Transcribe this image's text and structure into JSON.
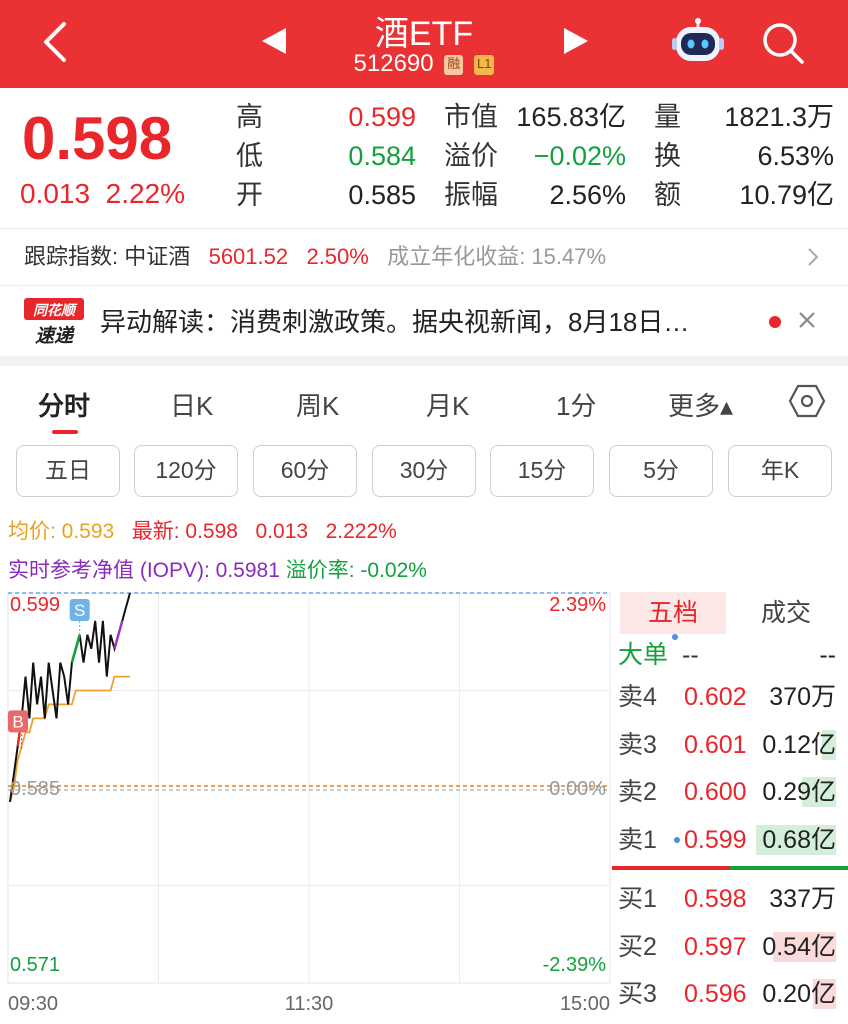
{
  "header": {
    "title": "酒ETF",
    "code": "512690",
    "tag_margin": "融",
    "tag_level": "L1",
    "bg_color": "#ea3133"
  },
  "quote": {
    "price": "0.598",
    "change": "0.013",
    "change_pct": "2.22%",
    "col1": [
      {
        "label": "高",
        "value": "0.599",
        "color": "red"
      },
      {
        "label": "低",
        "value": "0.584",
        "color": "green"
      },
      {
        "label": "开",
        "value": "0.585",
        "color": "black"
      }
    ],
    "col2": [
      {
        "label": "市值",
        "value": "165.83亿"
      },
      {
        "label": "溢价",
        "value": "−0.02%"
      },
      {
        "label": "振幅",
        "value": "2.56%"
      }
    ],
    "col3": [
      {
        "label": "量",
        "value": "1821.3万"
      },
      {
        "label": "换",
        "value": "6.53%"
      },
      {
        "label": "额",
        "value": "10.79亿"
      }
    ]
  },
  "tracking": {
    "label": "跟踪指数: 中证酒",
    "index_value": "5601.52",
    "index_pct": "2.50%",
    "annual_label": "成立年化收益: 15.47%"
  },
  "news": {
    "logo_top": "同花顺",
    "logo_bottom": "速递",
    "text": "异动解读：消费刺激政策。据央视新闻，8月18日…"
  },
  "tabs": {
    "items": [
      "分时",
      "日K",
      "周K",
      "月K",
      "1分",
      "更多▴"
    ],
    "active": 0
  },
  "periods": [
    "五日",
    "120分",
    "60分",
    "30分",
    "15分",
    "5分",
    "年K"
  ],
  "info": {
    "avg_label": "均价: 0.593",
    "latest_label": "最新: 0.598",
    "latest_change": "0.013",
    "latest_pct": "2.222%",
    "iopv": "实时参考净值 (IOPV): 0.5981",
    "premium": "溢价率: -0.02%"
  },
  "chart_data": {
    "type": "line",
    "y_ticks_left": [
      "0.599",
      "0.585",
      "0.571"
    ],
    "y_ticks_right": [
      "2.39%",
      "0.00%",
      "-2.39%"
    ],
    "x_ticks": [
      "09:30",
      "11:30",
      "15:00"
    ],
    "ylim": [
      0.571,
      0.599
    ],
    "prev_close": 0.585,
    "marker_buy": "B",
    "marker_sell": "S",
    "series": [
      {
        "values": [
          0.584,
          0.586,
          0.588,
          0.59,
          0.593,
          0.59,
          0.594,
          0.591,
          0.593,
          0.59,
          0.594,
          0.592,
          0.59,
          0.594,
          0.593,
          0.591,
          0.594,
          0.595,
          0.596,
          0.594,
          0.596,
          0.595,
          0.597,
          0.594,
          0.597,
          0.593,
          0.596,
          0.595,
          0.596,
          0.597,
          0.598,
          0.599
        ]
      },
      {
        "values": [
          0.584,
          0.585,
          0.587,
          0.588,
          0.589,
          0.589,
          0.59,
          0.59,
          0.59,
          0.59,
          0.591,
          0.591,
          0.591,
          0.591,
          0.591,
          0.591,
          0.591,
          0.592,
          0.592,
          0.592,
          0.592,
          0.592,
          0.592,
          0.592,
          0.592,
          0.592,
          0.592,
          0.593,
          0.593,
          0.593,
          0.593,
          0.593
        ]
      }
    ],
    "colors": {
      "price": "#111111",
      "avg": "#f0a030",
      "up": "#e8262b",
      "down": "#14a03c"
    }
  },
  "orderbook": {
    "tab_active": "五档",
    "tab_other": "成交",
    "big_label": "大单",
    "big_p": "--",
    "big_v": "--",
    "sells": [
      {
        "k": "卖4",
        "p": "0.602",
        "v": "370万",
        "bar": 0.0
      },
      {
        "k": "卖3",
        "p": "0.601",
        "v": "0.12亿",
        "bar": 0.18
      },
      {
        "k": "卖2",
        "p": "0.600",
        "v": "0.29亿",
        "bar": 0.43
      },
      {
        "k": "卖1",
        "p": "0.599",
        "v": "0.68亿",
        "bar": 1.0
      }
    ],
    "buys": [
      {
        "k": "买1",
        "p": "0.598",
        "v": "337万",
        "bar": 0.0
      },
      {
        "k": "买2",
        "p": "0.597",
        "v": "0.54亿",
        "bar": 0.79
      },
      {
        "k": "买3",
        "p": "0.596",
        "v": "0.20亿",
        "bar": 0.29
      }
    ]
  }
}
